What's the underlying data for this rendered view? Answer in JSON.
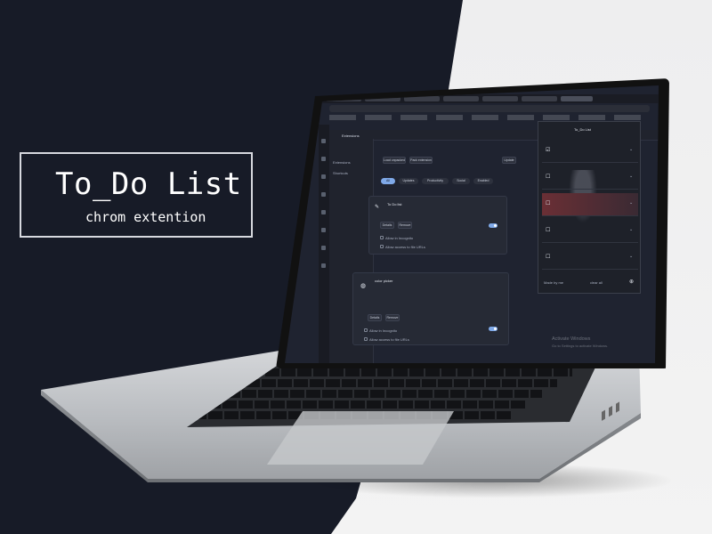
{
  "promo": {
    "title": "To_Do List",
    "subtitle": "chrom extention"
  },
  "browser": {
    "page_header": "Extensions",
    "sidebar": {
      "items": [
        "Extensions",
        "Shortcuts"
      ]
    },
    "toolbar": {
      "load_unpacked": "Load unpacked",
      "pack_extension": "Pack extension",
      "update": "Update"
    },
    "filter_chips": [
      "All",
      "Updates",
      "Productivity",
      "Social",
      "Enabled"
    ],
    "cards": [
      {
        "name": "To Do list",
        "buttons": [
          "Details",
          "Remove"
        ],
        "options": [
          "Allow in Incognito",
          "Allow access to file URLs"
        ]
      },
      {
        "name": "color picker",
        "buttons": [
          "Details",
          "Remove"
        ],
        "options": [
          "Allow in Incognito",
          "Allow access to file URLs"
        ]
      }
    ],
    "popup": {
      "title": "To_Do List",
      "footer_left": "Made by me",
      "footer_mid": "clear all"
    },
    "watermark": {
      "line1": "Activate Windows",
      "line2": "Go to Settings to activate Windows."
    }
  }
}
